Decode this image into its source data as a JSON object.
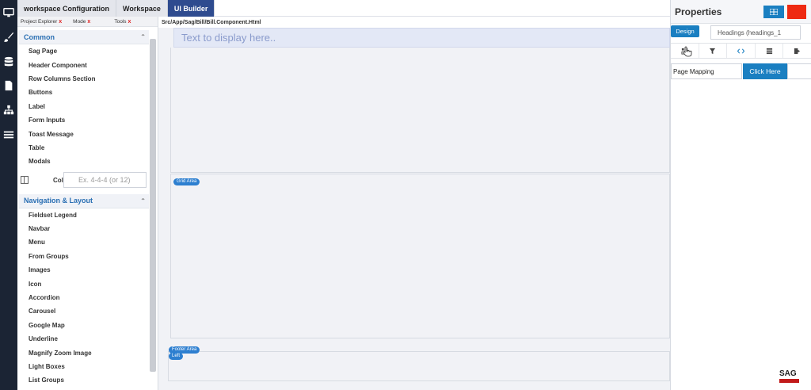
{
  "top_tabs": [
    {
      "label": "workspace Configuration",
      "active": false
    },
    {
      "label": "Workspace",
      "active": false
    },
    {
      "label": "UI Builder",
      "active": true
    }
  ],
  "left_panel": {
    "subtabs": [
      {
        "label": "Project Explorer",
        "close": "x"
      },
      {
        "label": "Mode",
        "close": "x"
      },
      {
        "label": "Tools",
        "close": "x"
      }
    ],
    "common": {
      "header": "Common",
      "items": [
        "Sag Page",
        "Header Component",
        "Row Columns Section",
        "Buttons",
        "Label",
        "Form Inputs",
        "Toast Message",
        "Table",
        "Modals"
      ]
    },
    "columns": {
      "label": "Col",
      "placeholder": "Ex. 4-4-4 (or 12)"
    },
    "nav_layout": {
      "header": "Navigation & Layout",
      "items": [
        "Fieldset Legend",
        "Navbar",
        "Menu",
        "From Groups",
        "Images",
        "Icon",
        "Accordion",
        "Carousel",
        "Google Map",
        "Underline",
        "Magnify Zoom Image",
        "Light Boxes",
        "List Groups"
      ]
    }
  },
  "canvas": {
    "path": "Src/App/Sag/Bill/Bill.Component.Html",
    "text_placeholder": "Text to display here..",
    "grid_badge": "Grid Area",
    "footer_badge_line1": "Footer Area",
    "footer_badge_line2": "Left"
  },
  "properties": {
    "title": "Properties",
    "design_tab": "Design",
    "selected_component": "Headings (headings_1",
    "page_mapping_label": "Page Mapping",
    "click_here_button": "Click Here",
    "logo_text": "SAG"
  },
  "colors": {
    "accent": "#1a7fc1",
    "active_tab": "#2e4b8f",
    "red_button": "#ee2a12",
    "rail": "#1b2434"
  },
  "icons": [
    "monitor-icon",
    "brush-icon",
    "database-icon",
    "document-icon",
    "sitemap-icon",
    "list-icon",
    "grid-icon",
    "design-icon",
    "filter-icon",
    "code-icon",
    "stack-icon",
    "export-icon",
    "columns-icon",
    "chevron-up-icon",
    "pointer-cursor-icon"
  ]
}
